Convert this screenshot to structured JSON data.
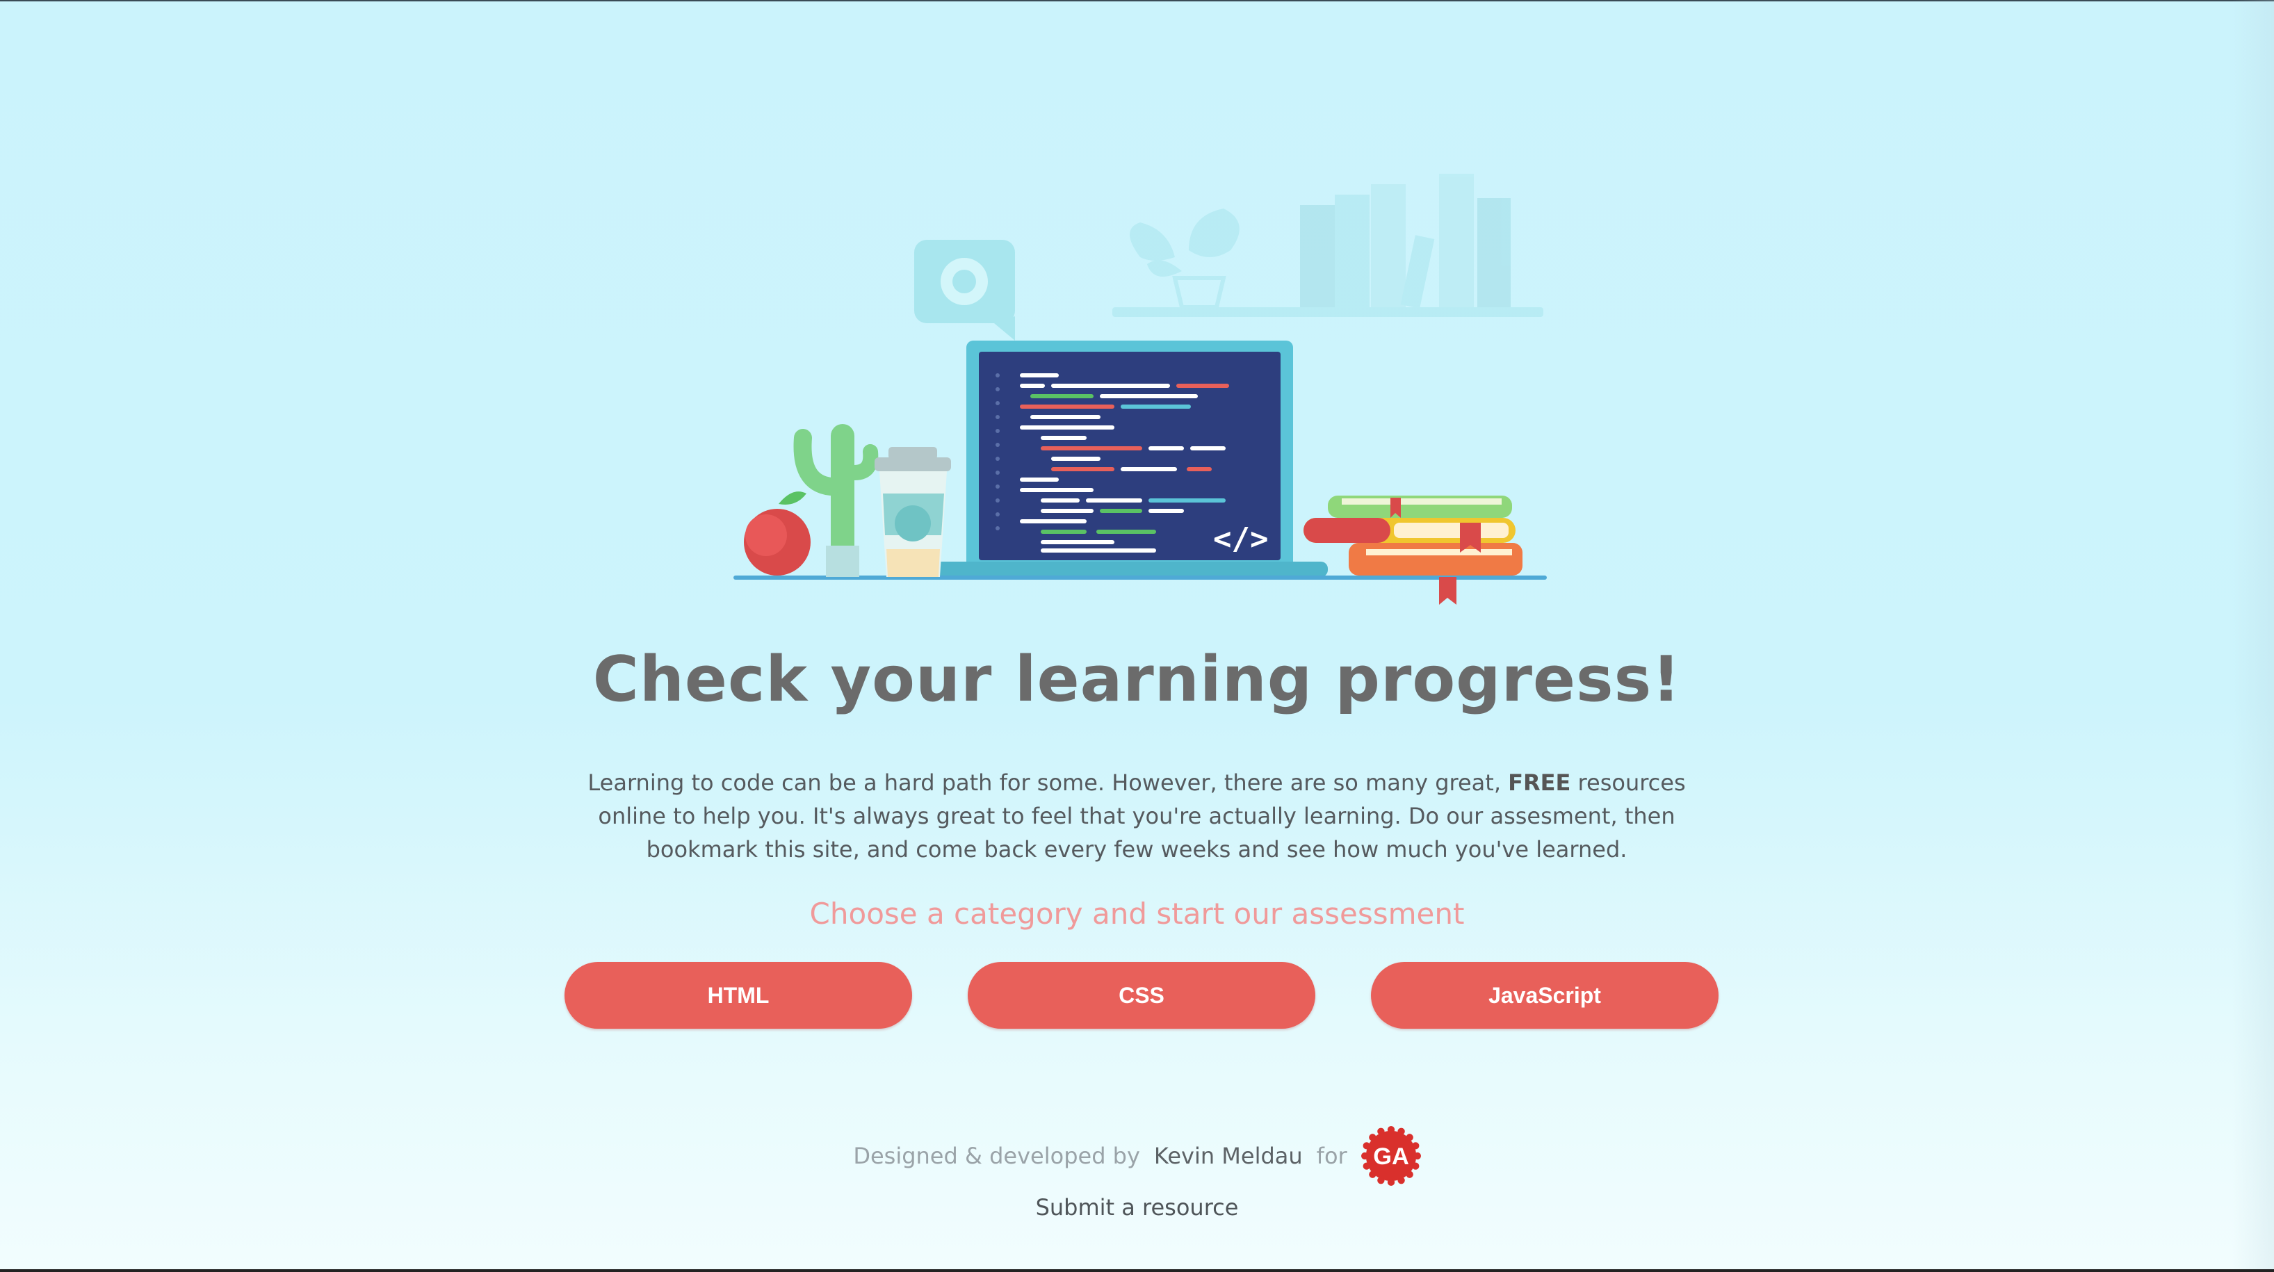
{
  "hero": {
    "code_tag": "</>"
  },
  "main": {
    "title": "Check your learning progress!",
    "intro_part1": "Learning to code can be a hard path for some. However, there are so many great, ",
    "intro_bold": "FREE",
    "intro_part2": " resources online to help you. It's always great to feel that you're actually learning. Do our assesment, then bookmark this site, and come back every few weeks and see how much you've learned.",
    "choose_label": "Choose a category and start our assessment",
    "categories": [
      {
        "label": "HTML"
      },
      {
        "label": "CSS"
      },
      {
        "label": "JavaScript"
      }
    ]
  },
  "footer": {
    "designed_by": "Designed & developed by",
    "author": "Kevin Meldau",
    "for": "for",
    "logo_text": "GA",
    "submit_link": "Submit a resource"
  },
  "colors": {
    "background": "#cbf3fc",
    "accent": "#e8605a",
    "title": "#6b6b6b",
    "choose": "#f09a9a"
  }
}
